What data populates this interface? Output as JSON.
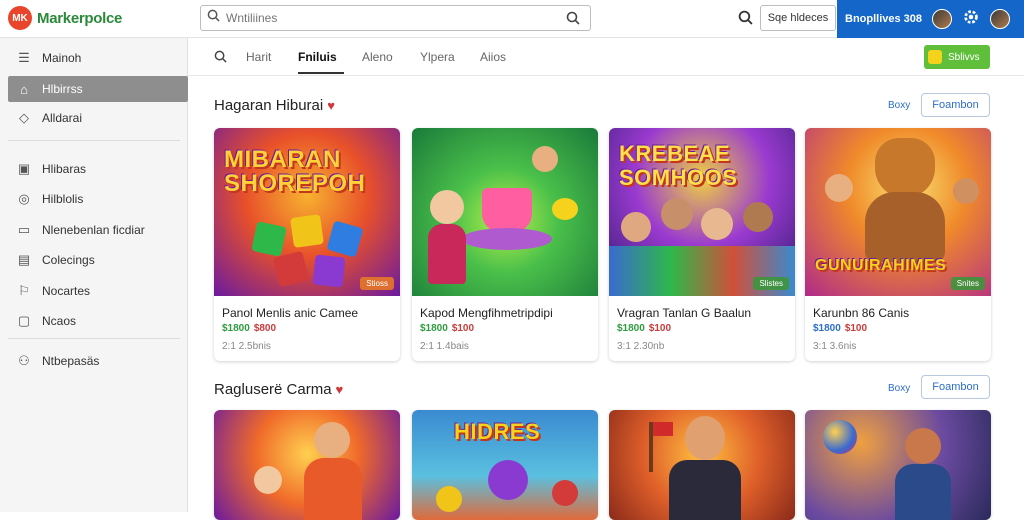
{
  "app": {
    "name": "Markerpolce",
    "logo_badge": "MK"
  },
  "search": {
    "placeholder": "Wntiliines",
    "value": ""
  },
  "top": {
    "pill_label": "Sqe hldeces",
    "account_label": "Bnopllives 308"
  },
  "sidebar": {
    "items": [
      {
        "label": "Mainoh",
        "icon": "menu-icon"
      },
      {
        "label": "Hlbirrss",
        "icon": "store-icon",
        "active": true
      },
      {
        "label": "Alldarai",
        "icon": "diamond-icon"
      },
      {
        "label": "Hlibaras",
        "icon": "bag-icon"
      },
      {
        "label": "Hilblolis",
        "icon": "compass-icon"
      },
      {
        "label": "Nlenebenlan ficdiar",
        "icon": "tv-icon"
      },
      {
        "label": "Colecings",
        "icon": "collection-icon"
      },
      {
        "label": "Nocartes",
        "icon": "bookmark-icon"
      },
      {
        "label": "Ncaos",
        "icon": "note-icon"
      },
      {
        "label": "Ntbepasäs",
        "icon": "person-icon"
      }
    ]
  },
  "tabs": {
    "items": [
      "Harit",
      "Fniluis",
      "Aleno",
      "Ylpera",
      "Aiios"
    ],
    "active_index": 1,
    "action_label": "Sblivvs"
  },
  "sections": [
    {
      "title": "Hagaran Hiburai",
      "link": "Boxy",
      "button": "Foambon",
      "cards": [
        {
          "art_text": "MIBARAN SHOREPOH",
          "title": "Panol Menlis anic Camee",
          "price1": "$1800",
          "price2": "$800",
          "meta": "2:1 2.5bnis",
          "tag": "Stioss"
        },
        {
          "art_text": "",
          "title": "Kapod Mengfihmetripdipi",
          "price1": "$1800",
          "price2": "$100",
          "meta": "2:1 1.4bais",
          "tag": ""
        },
        {
          "art_text": "KREBEAE SOMHOOS",
          "title": "Vragran Tanlan G Baalun",
          "price1": "$1800",
          "price2": "$100",
          "meta": "3:1 2.30nb",
          "tag": "Slistes"
        },
        {
          "art_text": "GUNUIRAHIMES",
          "title": "Karunbn 86 Canis",
          "price1": "$1800",
          "price2": "$100",
          "meta": "3:1 3.6nis",
          "tag": "Snites"
        }
      ]
    },
    {
      "title": "Ragluserë Carma",
      "link": "Boxy",
      "button": "Foambon",
      "cards": [
        {
          "art_text": ""
        },
        {
          "art_text": "HIDRES"
        },
        {
          "art_text": ""
        },
        {
          "art_text": ""
        }
      ]
    }
  ],
  "colors": {
    "brand": "#2a8a3a",
    "accent": "#1466c8",
    "sidebar_active": "#8e8e8e",
    "price_green": "#2e9c3e",
    "price_red": "#c83c3c"
  }
}
